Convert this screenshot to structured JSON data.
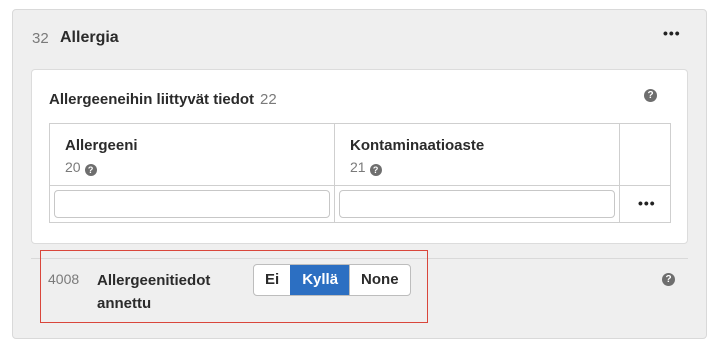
{
  "panel": {
    "number": "32",
    "title": "Allergia",
    "more": "•••"
  },
  "card": {
    "title": "Allergeeneihin liittyvät tiedot",
    "number": "22",
    "help": "?",
    "columns": [
      {
        "label": "Allergeeni",
        "number": "20",
        "help": "?"
      },
      {
        "label": "Kontaminaatioaste",
        "number": "21",
        "help": "?"
      }
    ],
    "row": {
      "inputs": [
        "",
        ""
      ],
      "more": "•••"
    }
  },
  "field": {
    "number": "4008",
    "label": "Allergeenitiedot annettu",
    "options": [
      "Ei",
      "Kyllä",
      "None"
    ],
    "selected": "Kyllä",
    "help": "?"
  },
  "colors": {
    "selected": "#2c6fc2",
    "highlight": "#d9463b",
    "panel_bg": "#efefef"
  }
}
